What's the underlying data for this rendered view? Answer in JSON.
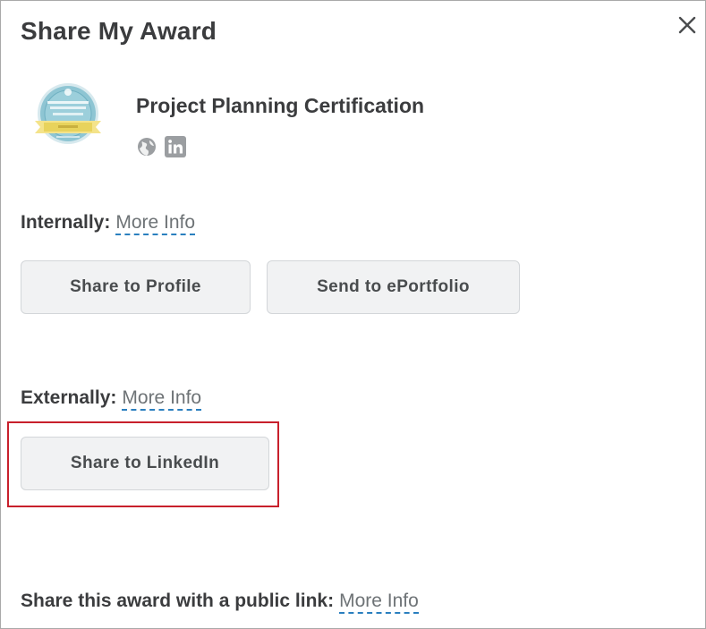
{
  "dialog": {
    "title": "Share My Award",
    "close_icon": "close-icon"
  },
  "award": {
    "name": "Project Planning Certification",
    "share_icons": [
      "globe-icon",
      "linkedin-icon"
    ]
  },
  "internally": {
    "label": "Internally:",
    "more_info": "More Info",
    "buttons": [
      "Share to Profile",
      "Send to ePortfolio"
    ]
  },
  "externally": {
    "label": "Externally:",
    "more_info": "More Info",
    "buttons": [
      "Share to LinkedIn"
    ]
  },
  "public_link": {
    "label": "Share this award with a public link:",
    "more_info": "More Info"
  },
  "colors": {
    "highlight": "#c8202c",
    "link_underline": "#2a7fbf",
    "button_bg": "#f1f2f3"
  }
}
